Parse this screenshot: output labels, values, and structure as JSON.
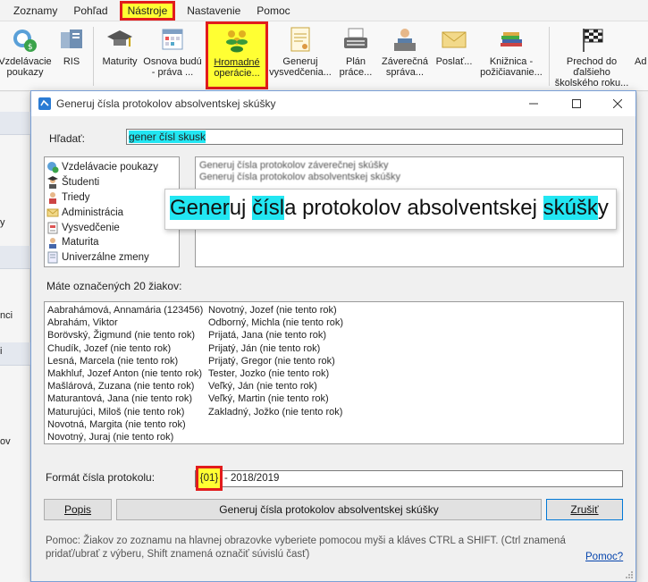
{
  "menu": {
    "items": [
      "Zoznamy",
      "Pohľad",
      "Nástroje",
      "Nastavenie",
      "Pomoc"
    ]
  },
  "ribbon": {
    "buttons": [
      {
        "line1": "Vzdelávacie",
        "line2": "poukazy",
        "icon": "voucher-icon"
      },
      {
        "line1": "RIS",
        "line2": "",
        "icon": "ris-icon"
      },
      {
        "line1": "Maturity",
        "line2": "",
        "icon": "graduation-cap-icon"
      },
      {
        "line1": "Osnova budú",
        "line2": "- práva ...",
        "icon": "calendar-icon"
      },
      {
        "line1": "Hromadné",
        "line2": "operácie...",
        "icon": "group-icon"
      },
      {
        "line1": "Generuj",
        "line2": "vysvedčenia...",
        "icon": "certificate-icon"
      },
      {
        "line1": "Plán",
        "line2": "práce...",
        "icon": "typewriter-icon"
      },
      {
        "line1": "Záverečná",
        "line2": "správa...",
        "icon": "report-icon"
      },
      {
        "line1": "Poslať...",
        "line2": "",
        "icon": "envelope-icon"
      },
      {
        "line1": "Knižnica -",
        "line2": "požičiavanie...",
        "icon": "books-icon"
      },
      {
        "line1": "Prechod do",
        "line2": "ďalšieho",
        "line3": "školského roku...",
        "icon": "checkered-flag-icon"
      },
      {
        "line1": "Ad",
        "line2": "",
        "icon": "more-icon"
      }
    ]
  },
  "leftpane": {
    "fragments": [
      "y",
      "nci",
      "i",
      "ov"
    ]
  },
  "dialog": {
    "title": "Generuj čísla protokolov absolventskej skúšky",
    "search_label": "Hľadať:",
    "search_value": "gener čísl skusk",
    "categories": [
      {
        "label": "Vzdelávacie poukazy",
        "icon": "voucher-icon"
      },
      {
        "label": "Študenti",
        "icon": "student-icon"
      },
      {
        "label": "Triedy",
        "icon": "class-icon"
      },
      {
        "label": "Administrácia",
        "icon": "envelope-icon"
      },
      {
        "label": "Vysvedčenie",
        "icon": "certificate-icon"
      },
      {
        "label": "Maturita",
        "icon": "graduation-icon"
      },
      {
        "label": "Univerzálne zmeny",
        "icon": "document-icon"
      }
    ],
    "results": [
      "Generuj čísla protokolov záverečnej skúšky",
      "Generuj čísla protokolov absolventskej skúšky"
    ],
    "tooltip": {
      "p1": "Gener",
      "m1": "uj ",
      "p2": "čísl",
      "m2": "a protokolov absolventskej ",
      "p3": "skúšk",
      "m3": "y"
    },
    "count_label": "Máte označených 20 žiakov:",
    "students_col1": [
      "Aabrahámová, Annamária (123456)",
      "Abrahám, Viktor",
      "Borövský, Žigmund (nie tento rok)",
      "Chudík, Jozef (nie tento rok)",
      "Lesná, Marcela (nie tento rok)",
      "Makhluf, Jozef Anton (nie tento rok)",
      "Mašlárová, Zuzana (nie tento rok)",
      "Maturantová, Jana (nie tento rok)",
      "Maturujúci, Miloš (nie tento rok)",
      "Novotná, Margita (nie tento rok)",
      "Novotný, Juraj (nie tento rok)"
    ],
    "students_col2": [
      "Novotný, Jozef (nie tento rok)",
      "Odborný, Michla (nie tento rok)",
      "Prijatá, Jana (nie tento rok)",
      "Prijatý, Ján (nie tento rok)",
      "Prijatý, Gregor (nie tento rok)",
      "Tester, Jozko (nie tento rok)",
      "Veľký, Ján (nie tento rok)",
      "Veľký, Martin (nie tento rok)",
      "Zakladný, Jožko (nie tento rok)"
    ],
    "format_label": "Formát čísla protokolu:",
    "format_token": "{01}",
    "format_rest": "- 2018/2019",
    "btn_popis": "Popis",
    "btn_generate": "Generuj čísla protokolov absolventskej skúšky",
    "btn_cancel": "Zrušiť",
    "help_text": "Pomoc: Žiakov zo zoznamu na hlavnej obrazovke vyberiete pomocou myši a kláves CTRL a SHIFT. (Ctrl znamená pridať/ubrať z výberu, Shift znamená označiť súvislú časť)",
    "help_link": "Pomoc?"
  },
  "colors": {
    "highlight_yellow": "#ffff33",
    "highlight_red": "#e21c1c",
    "match_cyan": "#22e6f2",
    "link_blue": "#0645ad"
  }
}
